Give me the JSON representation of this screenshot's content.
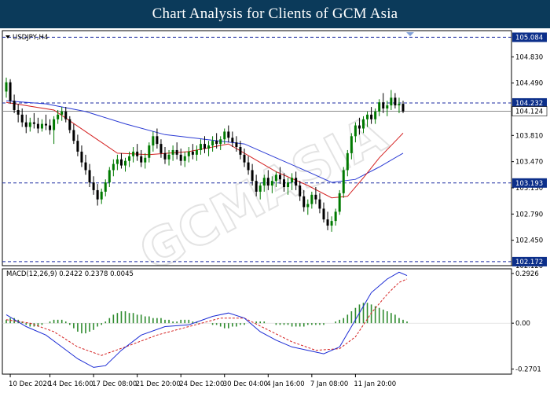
{
  "header": {
    "title": "Chart Analysis for Clients of GCM Asia"
  },
  "watermark": "GCMASIA",
  "chart_data": {
    "type": "candlestick",
    "symbol_label": "USDJPY,H4",
    "colors": {
      "up": "#007a00",
      "down": "#000000",
      "ma_fast": "#d42020",
      "ma_slow": "#2a3ad4",
      "macd_line": "#1a2ad4",
      "signal_line": "#d42020",
      "histogram": "#2e8b2e",
      "level_line": "#1a2aa0",
      "marker_bg": "#0c2f8a"
    },
    "ylim": [
      102.12,
      105.17
    ],
    "price_ticks": [
      "104.830",
      "104.490",
      "103.810",
      "103.470",
      "103.130",
      "102.790",
      "102.450",
      "102.120"
    ],
    "levels": [
      {
        "value": 105.084,
        "label": "105.084",
        "dashed": true
      },
      {
        "value": 104.232,
        "label": "104.232",
        "dashed": true
      },
      {
        "value": 104.124,
        "label": "104.124",
        "dashed": false,
        "current": true
      },
      {
        "value": 103.193,
        "label": "103.193",
        "dashed": true
      },
      {
        "value": 102.172,
        "label": "102.172",
        "dashed": true
      }
    ],
    "candles": [
      [
        104.38,
        104.56,
        104.3,
        104.5
      ],
      [
        104.5,
        104.54,
        104.22,
        104.26
      ],
      [
        104.26,
        104.34,
        104.1,
        104.14
      ],
      [
        104.14,
        104.22,
        103.98,
        104.08
      ],
      [
        104.08,
        104.16,
        103.92,
        103.98
      ],
      [
        103.98,
        104.08,
        103.84,
        103.92
      ],
      [
        103.92,
        104.04,
        103.86,
        103.98
      ],
      [
        103.98,
        104.1,
        103.9,
        103.96
      ],
      [
        103.96,
        104.04,
        103.84,
        103.9
      ],
      [
        103.9,
        104.02,
        103.86,
        103.96
      ],
      [
        103.96,
        104.08,
        103.88,
        103.94
      ],
      [
        103.94,
        104.02,
        103.82,
        103.88
      ],
      [
        103.88,
        104.06,
        103.7,
        104.02
      ],
      [
        104.02,
        104.14,
        103.96,
        104.08
      ],
      [
        104.08,
        104.18,
        104.0,
        104.12
      ],
      [
        104.12,
        104.18,
        103.98,
        104.02
      ],
      [
        104.02,
        104.06,
        103.84,
        103.88
      ],
      [
        103.88,
        103.96,
        103.7,
        103.74
      ],
      [
        103.74,
        103.82,
        103.54,
        103.6
      ],
      [
        103.6,
        103.68,
        103.4,
        103.46
      ],
      [
        103.46,
        103.56,
        103.3,
        103.36
      ],
      [
        103.36,
        103.44,
        103.14,
        103.2
      ],
      [
        103.2,
        103.28,
        103.04,
        103.1
      ],
      [
        103.1,
        103.18,
        102.9,
        102.98
      ],
      [
        102.98,
        103.12,
        102.92,
        103.08
      ],
      [
        103.08,
        103.24,
        103.02,
        103.2
      ],
      [
        103.2,
        103.4,
        103.14,
        103.36
      ],
      [
        103.36,
        103.5,
        103.28,
        103.44
      ],
      [
        103.44,
        103.56,
        103.36,
        103.5
      ],
      [
        103.5,
        103.58,
        103.38,
        103.42
      ],
      [
        103.42,
        103.52,
        103.34,
        103.48
      ],
      [
        103.48,
        103.6,
        103.4,
        103.54
      ],
      [
        103.54,
        103.66,
        103.46,
        103.6
      ],
      [
        103.6,
        103.7,
        103.48,
        103.54
      ],
      [
        103.54,
        103.62,
        103.4,
        103.46
      ],
      [
        103.46,
        103.58,
        103.38,
        103.52
      ],
      [
        103.52,
        103.72,
        103.46,
        103.68
      ],
      [
        103.68,
        103.86,
        103.6,
        103.8
      ],
      [
        103.8,
        103.9,
        103.64,
        103.7
      ],
      [
        103.7,
        103.76,
        103.52,
        103.58
      ],
      [
        103.58,
        103.66,
        103.44,
        103.5
      ],
      [
        103.5,
        103.62,
        103.42,
        103.56
      ],
      [
        103.56,
        103.68,
        103.48,
        103.62
      ],
      [
        103.62,
        103.72,
        103.5,
        103.56
      ],
      [
        103.56,
        103.64,
        103.42,
        103.48
      ],
      [
        103.48,
        103.6,
        103.4,
        103.54
      ],
      [
        103.54,
        103.66,
        103.46,
        103.6
      ],
      [
        103.6,
        103.7,
        103.5,
        103.56
      ],
      [
        103.56,
        103.68,
        103.48,
        103.62
      ],
      [
        103.62,
        103.76,
        103.56,
        103.7
      ],
      [
        103.7,
        103.8,
        103.58,
        103.64
      ],
      [
        103.64,
        103.74,
        103.54,
        103.68
      ],
      [
        103.68,
        103.8,
        103.6,
        103.74
      ],
      [
        103.74,
        103.84,
        103.64,
        103.7
      ],
      [
        103.7,
        103.8,
        103.62,
        103.76
      ],
      [
        103.76,
        103.9,
        103.7,
        103.86
      ],
      [
        103.86,
        103.94,
        103.72,
        103.78
      ],
      [
        103.78,
        103.86,
        103.66,
        103.72
      ],
      [
        103.72,
        103.8,
        103.6,
        103.66
      ],
      [
        103.66,
        103.74,
        103.5,
        103.56
      ],
      [
        103.56,
        103.64,
        103.4,
        103.46
      ],
      [
        103.46,
        103.54,
        103.3,
        103.36
      ],
      [
        103.36,
        103.44,
        103.16,
        103.22
      ],
      [
        103.22,
        103.3,
        103.02,
        103.08
      ],
      [
        103.08,
        103.2,
        102.98,
        103.16
      ],
      [
        103.16,
        103.3,
        103.08,
        103.26
      ],
      [
        103.26,
        103.36,
        103.1,
        103.16
      ],
      [
        103.16,
        103.28,
        103.06,
        103.22
      ],
      [
        103.22,
        103.34,
        103.14,
        103.3
      ],
      [
        103.3,
        103.4,
        103.18,
        103.24
      ],
      [
        103.24,
        103.32,
        103.08,
        103.14
      ],
      [
        103.14,
        103.26,
        103.04,
        103.2
      ],
      [
        103.2,
        103.32,
        103.1,
        103.26
      ],
      [
        103.26,
        103.34,
        103.1,
        103.16
      ],
      [
        103.16,
        103.22,
        102.96,
        103.02
      ],
      [
        103.02,
        103.1,
        102.82,
        102.88
      ],
      [
        102.88,
        102.98,
        102.78,
        102.92
      ],
      [
        102.92,
        103.08,
        102.86,
        103.04
      ],
      [
        103.04,
        103.14,
        102.92,
        102.98
      ],
      [
        102.98,
        103.06,
        102.8,
        102.86
      ],
      [
        102.86,
        102.94,
        102.68,
        102.72
      ],
      [
        102.72,
        102.82,
        102.58,
        102.64
      ],
      [
        102.64,
        102.76,
        102.56,
        102.7
      ],
      [
        102.7,
        102.86,
        102.64,
        102.82
      ],
      [
        102.82,
        103.1,
        102.78,
        103.06
      ],
      [
        103.06,
        103.4,
        103.0,
        103.36
      ],
      [
        103.36,
        103.62,
        103.28,
        103.58
      ],
      [
        103.58,
        103.84,
        103.5,
        103.8
      ],
      [
        103.8,
        103.98,
        103.72,
        103.94
      ],
      [
        103.94,
        104.04,
        103.82,
        103.9
      ],
      [
        103.9,
        104.06,
        103.84,
        104.02
      ],
      [
        104.02,
        104.12,
        103.92,
        104.08
      ],
      [
        104.08,
        104.18,
        103.96,
        104.02
      ],
      [
        104.02,
        104.16,
        103.96,
        104.12
      ],
      [
        104.12,
        104.28,
        104.06,
        104.24
      ],
      [
        104.24,
        104.36,
        104.1,
        104.16
      ],
      [
        104.16,
        104.26,
        104.06,
        104.2
      ],
      [
        104.2,
        104.4,
        104.14,
        104.3
      ],
      [
        104.3,
        104.36,
        104.16,
        104.2
      ],
      [
        104.2,
        104.3,
        104.1,
        104.22
      ],
      [
        104.22,
        104.26,
        104.1,
        104.12
      ]
    ],
    "ma_fast": [
      [
        0,
        104.24
      ],
      [
        12,
        104.14
      ],
      [
        20,
        103.86
      ],
      [
        28,
        103.58
      ],
      [
        36,
        103.56
      ],
      [
        46,
        103.6
      ],
      [
        56,
        103.7
      ],
      [
        62,
        103.52
      ],
      [
        68,
        103.34
      ],
      [
        76,
        103.16
      ],
      [
        82,
        103.0
      ],
      [
        86,
        103.02
      ],
      [
        90,
        103.26
      ],
      [
        94,
        103.52
      ],
      [
        100,
        103.84
      ]
    ],
    "ma_slow": [
      [
        0,
        104.26
      ],
      [
        10,
        104.22
      ],
      [
        20,
        104.12
      ],
      [
        30,
        103.96
      ],
      [
        40,
        103.82
      ],
      [
        50,
        103.76
      ],
      [
        60,
        103.7
      ],
      [
        68,
        103.52
      ],
      [
        76,
        103.34
      ],
      [
        82,
        103.2
      ],
      [
        88,
        103.24
      ],
      [
        94,
        103.4
      ],
      [
        100,
        103.58
      ]
    ],
    "macd": {
      "label": "MACD(12,26,9) 0.2422 0.2378 0.0045",
      "ylim": [
        -0.3,
        0.32
      ],
      "ticks": [
        {
          "value": 0.2926,
          "label": "0.2926"
        },
        {
          "value": 0.0,
          "label": "0.00"
        },
        {
          "value": -0.2701,
          "label": "-0.2701"
        }
      ],
      "line": [
        [
          0,
          0.05
        ],
        [
          5,
          -0.02
        ],
        [
          10,
          -0.07
        ],
        [
          14,
          -0.14
        ],
        [
          18,
          -0.21
        ],
        [
          22,
          -0.26
        ],
        [
          25,
          -0.25
        ],
        [
          29,
          -0.16
        ],
        [
          34,
          -0.07
        ],
        [
          40,
          -0.02
        ],
        [
          46,
          -0.01
        ],
        [
          52,
          0.04
        ],
        [
          56,
          0.06
        ],
        [
          60,
          0.03
        ],
        [
          64,
          -0.05
        ],
        [
          68,
          -0.1
        ],
        [
          72,
          -0.14
        ],
        [
          76,
          -0.16
        ],
        [
          80,
          -0.18
        ],
        [
          84,
          -0.14
        ],
        [
          88,
          0.02
        ],
        [
          92,
          0.18
        ],
        [
          96,
          0.26
        ],
        [
          99,
          0.3
        ],
        [
          101,
          0.28
        ]
      ],
      "signal": [
        [
          0,
          0.02
        ],
        [
          6,
          0.0
        ],
        [
          12,
          -0.05
        ],
        [
          18,
          -0.14
        ],
        [
          24,
          -0.19
        ],
        [
          30,
          -0.14
        ],
        [
          38,
          -0.07
        ],
        [
          46,
          -0.02
        ],
        [
          54,
          0.03
        ],
        [
          60,
          0.03
        ],
        [
          66,
          -0.04
        ],
        [
          72,
          -0.11
        ],
        [
          78,
          -0.16
        ],
        [
          84,
          -0.15
        ],
        [
          88,
          -0.08
        ],
        [
          92,
          0.06
        ],
        [
          96,
          0.17
        ],
        [
          99,
          0.24
        ],
        [
          101,
          0.26
        ]
      ],
      "histogram": [
        0.02,
        0.03,
        0.03,
        0.02,
        0.01,
        -0.01,
        -0.02,
        -0.02,
        -0.02,
        -0.01,
        0.0,
        0.01,
        0.02,
        0.02,
        0.02,
        0.01,
        -0.01,
        -0.03,
        -0.05,
        -0.06,
        -0.06,
        -0.05,
        -0.04,
        -0.02,
        -0.01,
        0.01,
        0.03,
        0.05,
        0.06,
        0.07,
        0.07,
        0.06,
        0.06,
        0.05,
        0.05,
        0.04,
        0.04,
        0.03,
        0.03,
        0.03,
        0.02,
        0.02,
        0.01,
        0.01,
        0.02,
        0.02,
        0.02,
        0.01,
        0.01,
        0.0,
        0.0,
        0.0,
        -0.01,
        -0.01,
        -0.02,
        -0.03,
        -0.03,
        -0.02,
        -0.02,
        -0.01,
        -0.01,
        0.0,
        0.0,
        0.01,
        0.01,
        0.01,
        0.0,
        0.0,
        -0.01,
        -0.01,
        -0.01,
        -0.01,
        -0.02,
        -0.02,
        -0.02,
        -0.02,
        -0.01,
        -0.01,
        -0.01,
        -0.01,
        -0.01,
        0.0,
        0.0,
        0.01,
        0.02,
        0.03,
        0.05,
        0.07,
        0.09,
        0.11,
        0.12,
        0.12,
        0.11,
        0.1,
        0.09,
        0.08,
        0.07,
        0.06,
        0.05,
        0.03,
        0.02,
        0.01
      ]
    },
    "x_ticks": [
      {
        "index": 1,
        "label": "10 Dec 2020"
      },
      {
        "index": 11,
        "label": "14 Dec 16:00"
      },
      {
        "index": 22,
        "label": "17 Dec 08:00"
      },
      {
        "index": 33,
        "label": "21 Dec 20:00"
      },
      {
        "index": 44,
        "label": "24 Dec 12:00"
      },
      {
        "index": 55,
        "label": "30 Dec 04:00"
      },
      {
        "index": 66,
        "label": "4 Jan 16:00"
      },
      {
        "index": 77,
        "label": "7 Jan 08:00"
      },
      {
        "index": 88,
        "label": "11 Jan 20:00"
      }
    ]
  }
}
